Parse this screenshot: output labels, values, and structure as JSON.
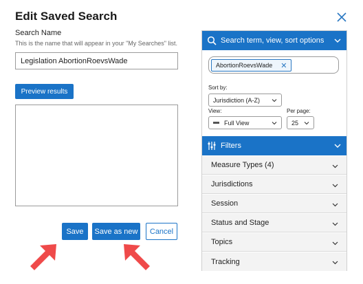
{
  "dialog": {
    "title": "Edit Saved Search",
    "name_label": "Search Name",
    "name_hint": "This is the name that will appear in your \"My Searches\" list.",
    "name_value": "Legislation AbortionRoevsWade",
    "preview_label": "Preview results",
    "save_label": "Save",
    "save_as_new_label": "Save as new",
    "cancel_label": "Cancel"
  },
  "panel": {
    "search_header": "Search term, view, sort options",
    "search_tag": "AbortionRoevsWade",
    "sort_label": "Sort by:",
    "sort_value": "Jurisdiction (A-Z)",
    "view_label": "View:",
    "view_value": "Full View",
    "per_page_label": "Per page:",
    "per_page_value": "25",
    "filters_header": "Filters",
    "facets": [
      "Measure Types (4)",
      "Jurisdictions",
      "Session",
      "Status and Stage",
      "Topics",
      "Tracking"
    ]
  },
  "colors": {
    "accent": "#1a73c7",
    "annotation_arrow": "#ef4a4a"
  },
  "icons": [
    "close-icon",
    "search-icon",
    "filter-sliders-icon",
    "chevron-down-icon",
    "annotation-arrow"
  ]
}
